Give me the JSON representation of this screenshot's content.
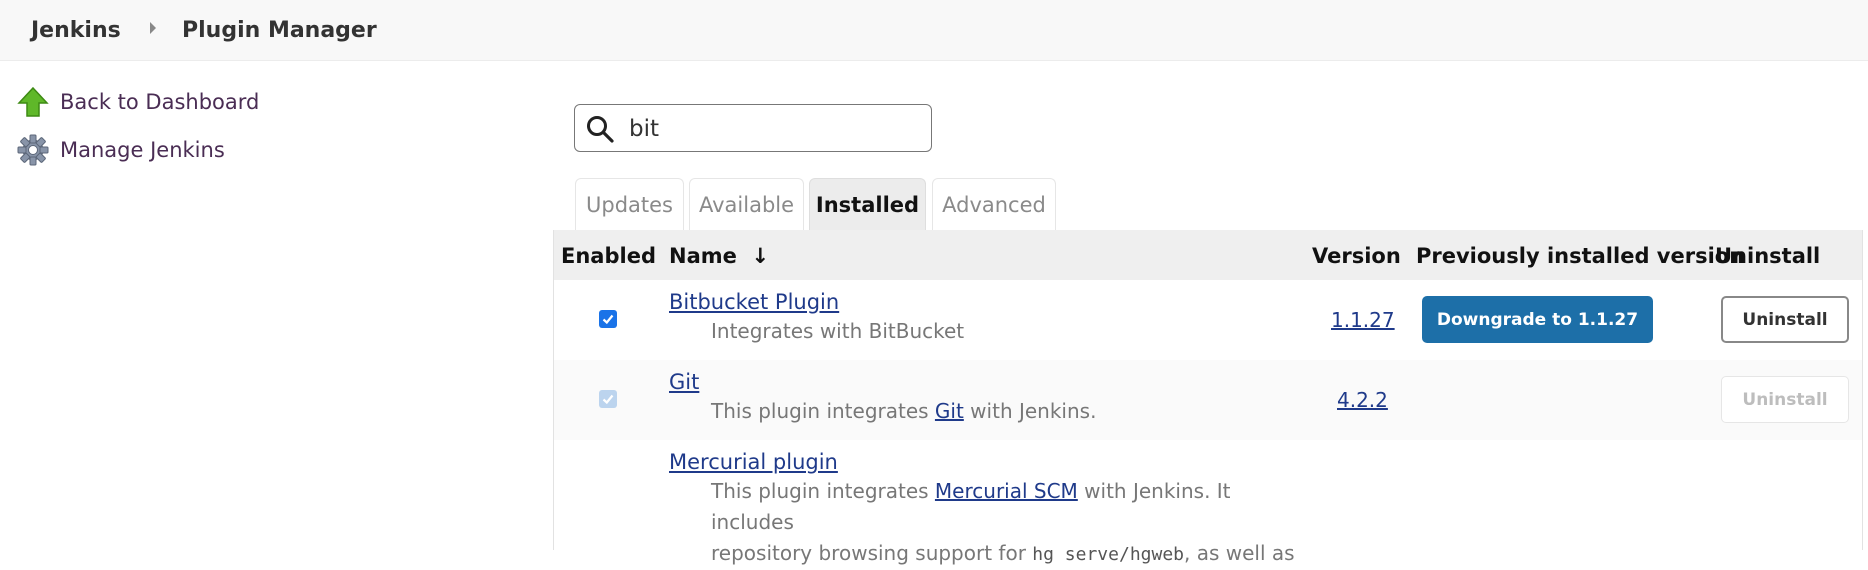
{
  "breadcrumb": {
    "root": "Jenkins",
    "current": "Plugin Manager"
  },
  "sidebar": {
    "items": [
      {
        "label": "Back to Dashboard",
        "icon": "up-arrow-icon"
      },
      {
        "label": "Manage Jenkins",
        "icon": "gear-icon"
      }
    ]
  },
  "search": {
    "value": "bit",
    "placeholder": ""
  },
  "tabs": [
    {
      "label": "Updates",
      "active": false
    },
    {
      "label": "Available",
      "active": false
    },
    {
      "label": "Installed",
      "active": true
    },
    {
      "label": "Advanced",
      "active": false
    }
  ],
  "table": {
    "headers": {
      "enabled": "Enabled",
      "name": "Name  ↓",
      "version": "Version",
      "previous": "Previously installed version",
      "uninstall": "Uninstall"
    },
    "rows": [
      {
        "name": "Bitbucket Plugin",
        "desc": "Integrates with BitBucket",
        "version": "1.1.27",
        "enabled": true,
        "downgrade": "Downgrade to 1.1.27",
        "uninstall": "Uninstall"
      },
      {
        "name": "Git",
        "desc_pre": "This plugin integrates ",
        "desc_link": "Git",
        "desc_post": " with Jenkins.",
        "version": "4.2.2",
        "enabled": true,
        "uninstall": "Uninstall"
      },
      {
        "name": "Mercurial plugin",
        "desc_pre": "This plugin integrates ",
        "desc_link": "Mercurial SCM",
        "desc_post": " with Jenkins. It includes",
        "desc_line2_pre": "repository browsing support for ",
        "desc_code": "hg serve/hgweb",
        "desc_line2_post": ", as well as"
      }
    ]
  },
  "colors": {
    "accent": "#1d6fa8",
    "link": "#1f3a8a",
    "sidebar_link": "#4a2d54"
  }
}
